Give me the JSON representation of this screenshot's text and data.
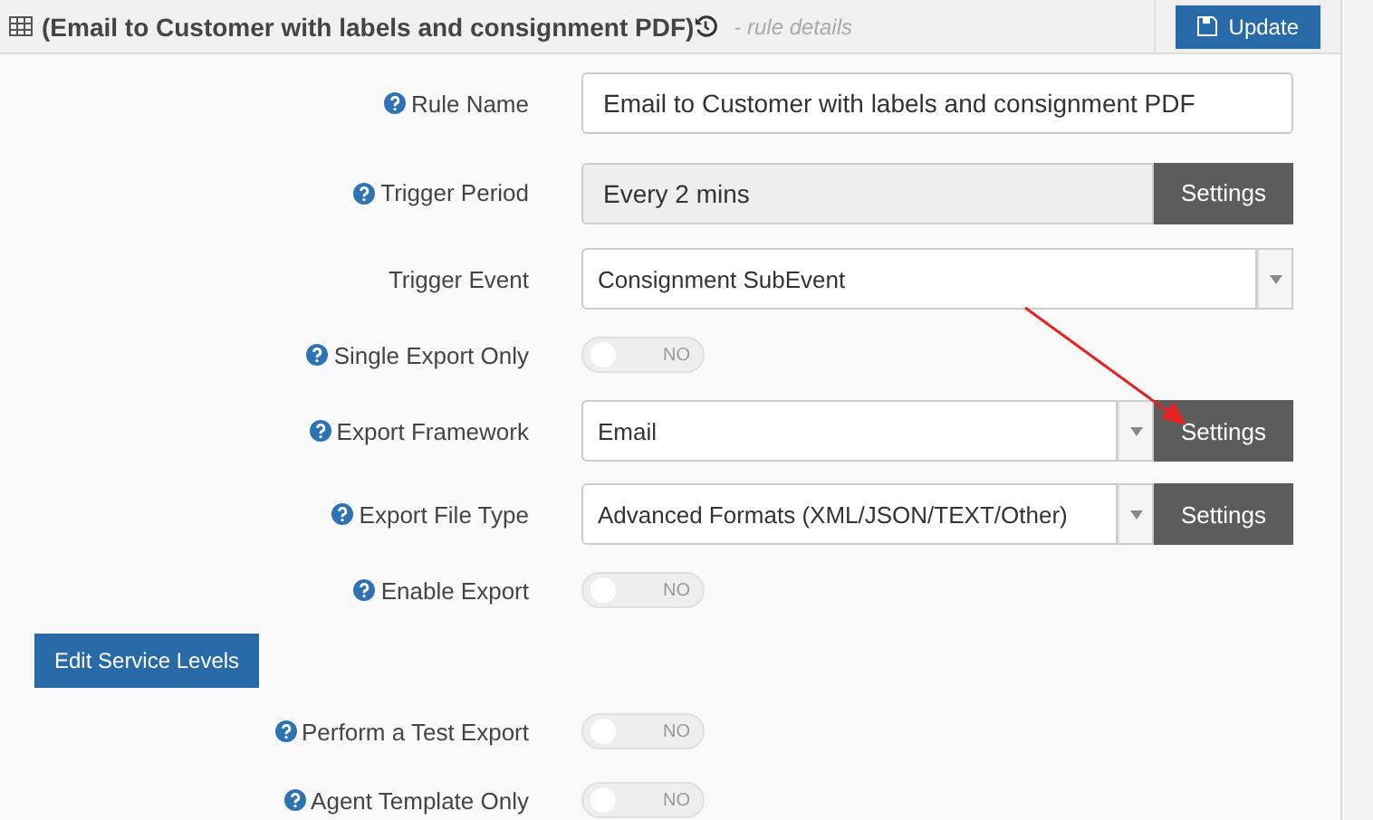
{
  "header": {
    "title": "(Email to Customer with labels and consignment PDF)",
    "subtitle": "- rule details",
    "update_button": "Update"
  },
  "rows": [
    {
      "kind": "input",
      "label": "Rule Name",
      "help": true,
      "value": "Email to Customer with labels and consignment PDF"
    },
    {
      "kind": "readonly",
      "label": "Trigger Period",
      "help": true,
      "value": "Every 2 mins",
      "button": "Settings"
    },
    {
      "kind": "select",
      "label": "Trigger Event",
      "help": false,
      "value": "Consignment SubEvent"
    },
    {
      "kind": "toggle",
      "label": "Single Export Only",
      "help": true,
      "on": false,
      "state_text": "NO"
    },
    {
      "kind": "select",
      "label": "Export Framework",
      "help": true,
      "value": "Email",
      "button": "Settings"
    },
    {
      "kind": "select",
      "label": "Export File Type",
      "help": true,
      "value": "Advanced Formats (XML/JSON/TEXT/Other)",
      "button": "Settings"
    },
    {
      "kind": "toggle",
      "label": "Enable Export",
      "help": true,
      "on": false,
      "state_text": "NO"
    },
    {
      "kind": "button",
      "label": "Edit Service Levels"
    },
    {
      "kind": "toggle",
      "label": "Perform a Test Export",
      "help": true,
      "on": false,
      "state_text": "NO"
    },
    {
      "kind": "toggle",
      "label": "Agent Template Only",
      "help": true,
      "on": false,
      "state_text": "NO"
    }
  ]
}
